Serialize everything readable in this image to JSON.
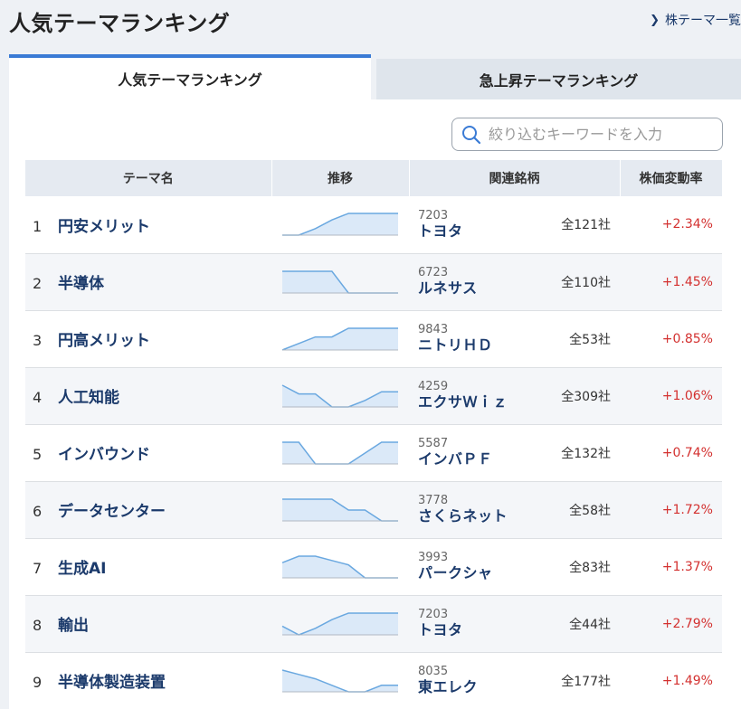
{
  "header": {
    "title": "人気テーマランキング",
    "list_link": "株テーマ一覧"
  },
  "tabs": [
    {
      "label": "人気テーマランキング",
      "active": true
    },
    {
      "label": "急上昇テーマランキング",
      "active": false
    }
  ],
  "search": {
    "placeholder": "絞り込むキーワードを入力"
  },
  "table": {
    "columns": [
      "テーマ名",
      "推移",
      "関連銘柄",
      "株価変動率"
    ],
    "rows": [
      {
        "rank": "1",
        "theme": "円安メリット",
        "code": "7203",
        "stock": "トヨタ",
        "count": "全121社",
        "change": "+2.34%",
        "trend": [
          0,
          0,
          0.3,
          0.7,
          1,
          1,
          1,
          1
        ]
      },
      {
        "rank": "2",
        "theme": "半導体",
        "code": "6723",
        "stock": "ルネサス",
        "count": "全110社",
        "change": "+1.45%",
        "trend": [
          1,
          1,
          1,
          1,
          0,
          0,
          0,
          0
        ]
      },
      {
        "rank": "3",
        "theme": "円高メリット",
        "code": "9843",
        "stock": "ニトリＨＤ",
        "count": "全53社",
        "change": "+0.85%",
        "trend": [
          0,
          0.3,
          0.6,
          0.6,
          1,
          1,
          1,
          1
        ]
      },
      {
        "rank": "4",
        "theme": "人工知能",
        "code": "4259",
        "stock": "エクサＷｉｚ",
        "count": "全309社",
        "change": "+1.06%",
        "trend": [
          1,
          0.6,
          0.6,
          0,
          0,
          0.3,
          0.7,
          0.7
        ]
      },
      {
        "rank": "5",
        "theme": "インバウンド",
        "code": "5587",
        "stock": "インバＰＦ",
        "count": "全132社",
        "change": "+0.74%",
        "trend": [
          1,
          1,
          0,
          0,
          0,
          0.5,
          1,
          1
        ]
      },
      {
        "rank": "6",
        "theme": "データセンター",
        "code": "3778",
        "stock": "さくらネット",
        "count": "全58社",
        "change": "+1.72%",
        "trend": [
          1,
          1,
          1,
          1,
          0.5,
          0.5,
          0,
          0
        ]
      },
      {
        "rank": "7",
        "theme": "生成AI",
        "code": "3993",
        "stock": "パークシャ",
        "count": "全83社",
        "change": "+1.37%",
        "trend": [
          0.7,
          1,
          1,
          0.8,
          0.6,
          0,
          0,
          0
        ]
      },
      {
        "rank": "8",
        "theme": "輸出",
        "code": "7203",
        "stock": "トヨタ",
        "count": "全44社",
        "change": "+2.79%",
        "trend": [
          0.4,
          0,
          0.3,
          0.7,
          1,
          1,
          1,
          1
        ]
      },
      {
        "rank": "9",
        "theme": "半導体製造装置",
        "code": "8035",
        "stock": "東エレク",
        "count": "全177社",
        "change": "+1.49%",
        "trend": [
          1,
          0.8,
          0.6,
          0.3,
          0,
          0,
          0.3,
          0.3
        ]
      }
    ]
  },
  "colors": {
    "accent": "#3a7bd5",
    "link": "#1b3a6b",
    "positive": "#d3302f",
    "spark_line": "#6aa8e0",
    "spark_fill": "#dbe9f8",
    "spark_base": "#b0b8c2"
  }
}
